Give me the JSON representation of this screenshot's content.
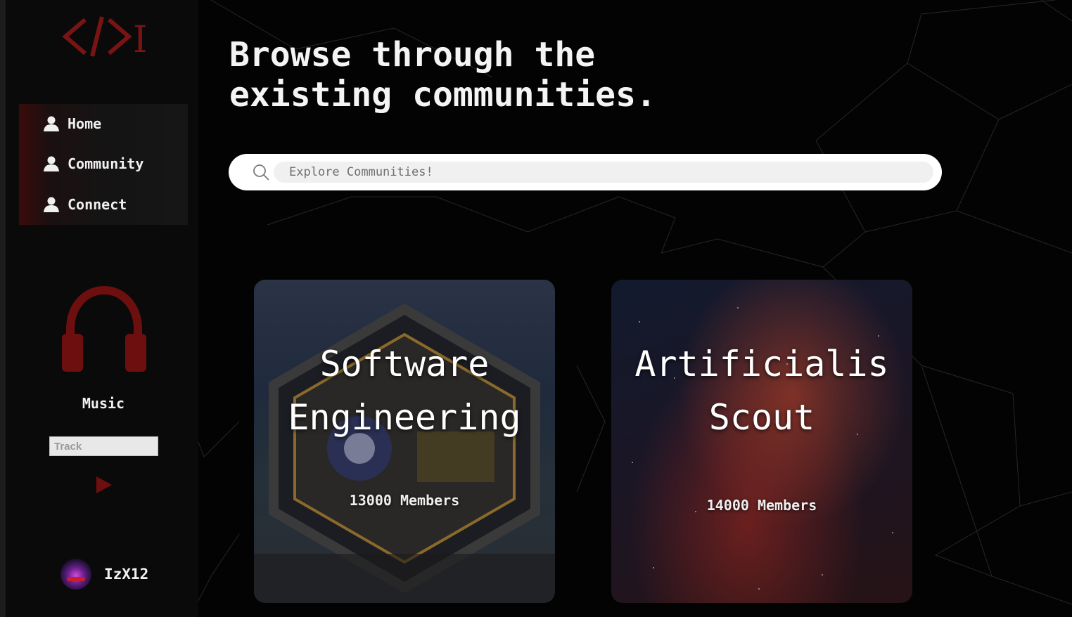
{
  "logo": {
    "text": "</>I",
    "color": "#8b1a1a"
  },
  "nav": {
    "items": [
      {
        "label": "Home",
        "icon": "user-icon"
      },
      {
        "label": "Community",
        "icon": "user-icon"
      },
      {
        "label": "Connect",
        "icon": "user-icon"
      }
    ]
  },
  "music": {
    "label": "Music",
    "icon": "headphones-icon",
    "track_placeholder": "Track",
    "play_icon": "play-icon",
    "accent": "#7a1010"
  },
  "user": {
    "name": "IzX12"
  },
  "main": {
    "headline_line1": "Browse through the",
    "headline_line2": "existing communities.",
    "search_placeholder": "Explore Communities!"
  },
  "communities": [
    {
      "title_line1": "Software",
      "title_line2": "Engineering",
      "members": "13000 Members"
    },
    {
      "title_line1": "Artificialis",
      "title_line2": "Scout",
      "members": "14000 Members"
    }
  ]
}
